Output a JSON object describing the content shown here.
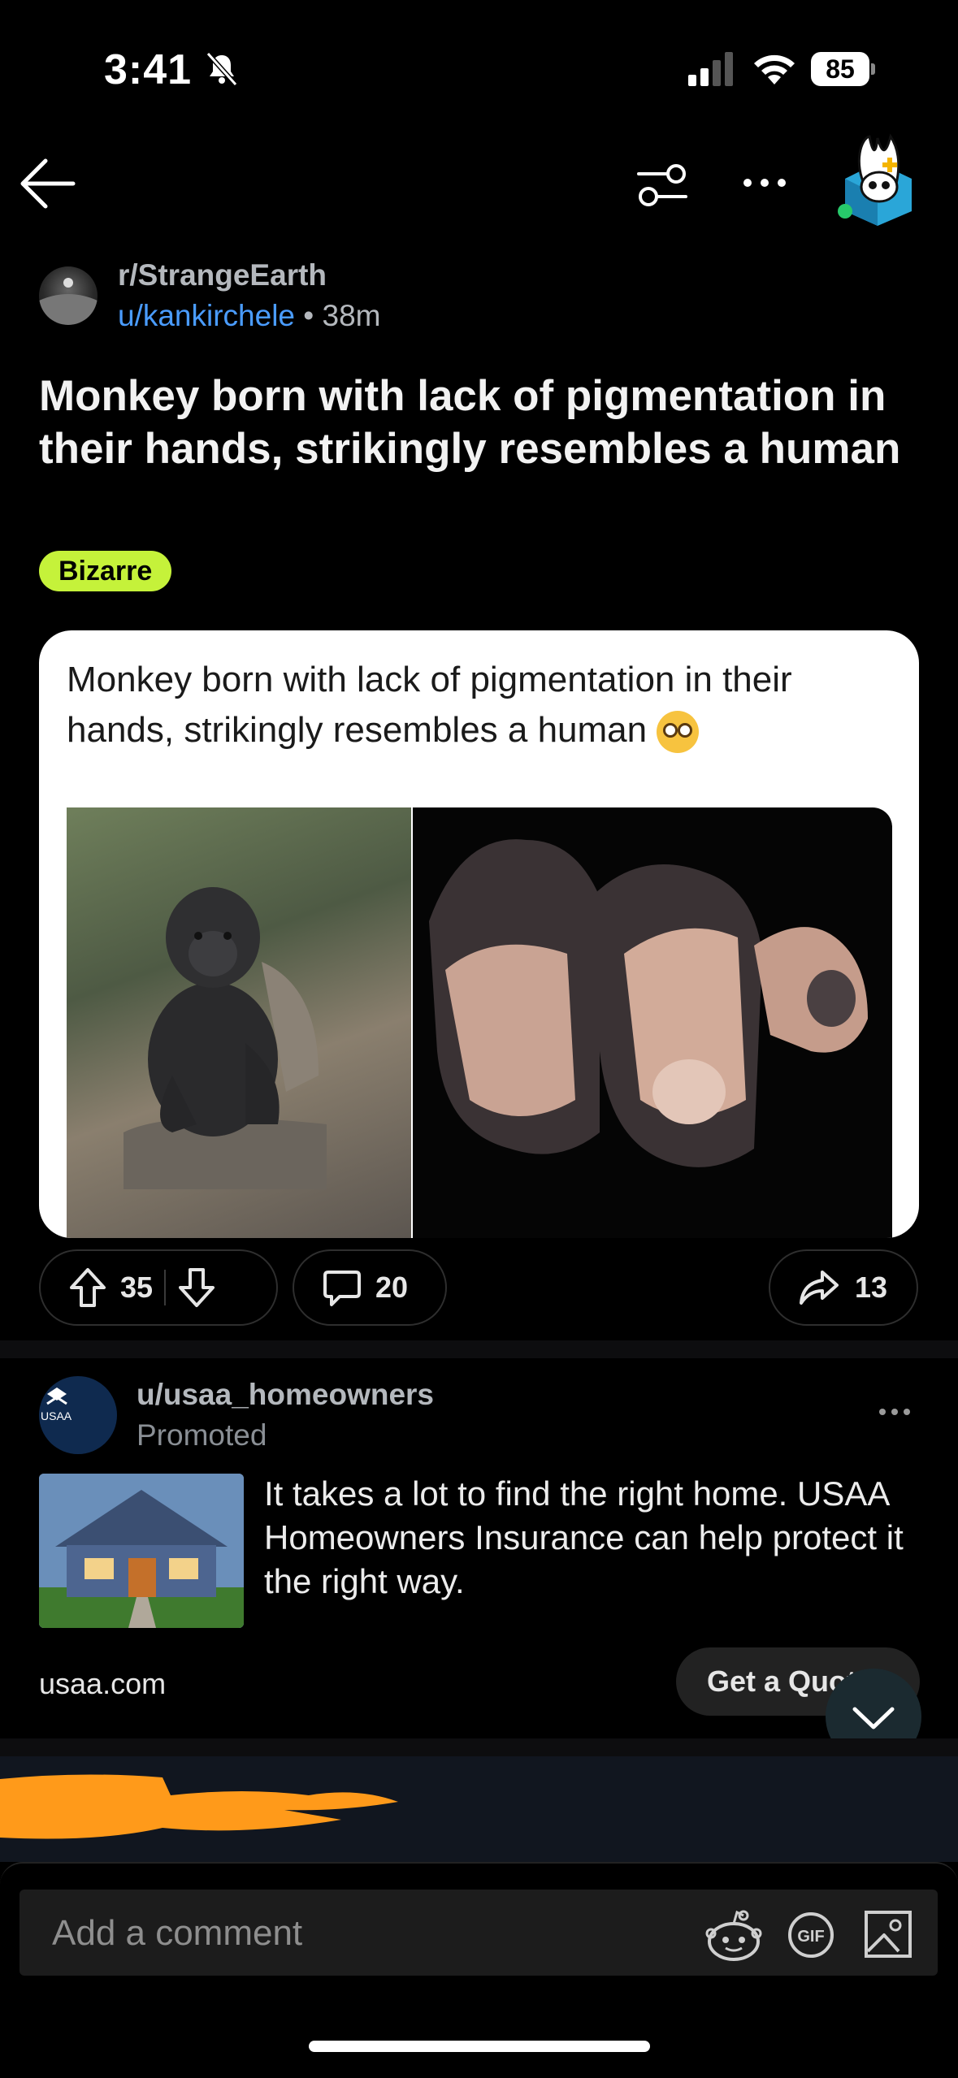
{
  "status": {
    "time": "3:41",
    "battery": "85"
  },
  "post": {
    "subreddit": "r/StrangeEarth",
    "author": "u/kankirchele",
    "separator": " • ",
    "age": "38m",
    "title": "Monkey born with lack of pigmentation in their hands, strikingly resembles a human",
    "flair": "Bizarre",
    "image_caption": "Monkey born with lack of pigmentation in their hands, strikingly resembles a human",
    "votes": "35",
    "comments": "20",
    "shares": "13"
  },
  "ad": {
    "user": "u/usaa_homeowners",
    "promoted": "Promoted",
    "logo_text": "USAA",
    "text": "It takes a lot to find the right home. USAA Homeowners Insurance can help protect it the right way.",
    "domain": "usaa.com",
    "cta": "Get a Quote"
  },
  "composer": {
    "placeholder": "Add a comment",
    "gif_label": "GIF"
  },
  "colors": {
    "flair": "#c5f23a",
    "link": "#4a9cff",
    "redaction": "#ff9a1a"
  },
  "icons": [
    "back-arrow-icon",
    "filter-icon",
    "more-icon",
    "snoo-avatar-icon",
    "upvote-icon",
    "downvote-icon",
    "comment-icon",
    "share-icon",
    "chevron-down-icon",
    "emoji-icon",
    "gif-icon",
    "image-icon",
    "silent-bell-icon",
    "signal-icon",
    "wifi-icon"
  ]
}
